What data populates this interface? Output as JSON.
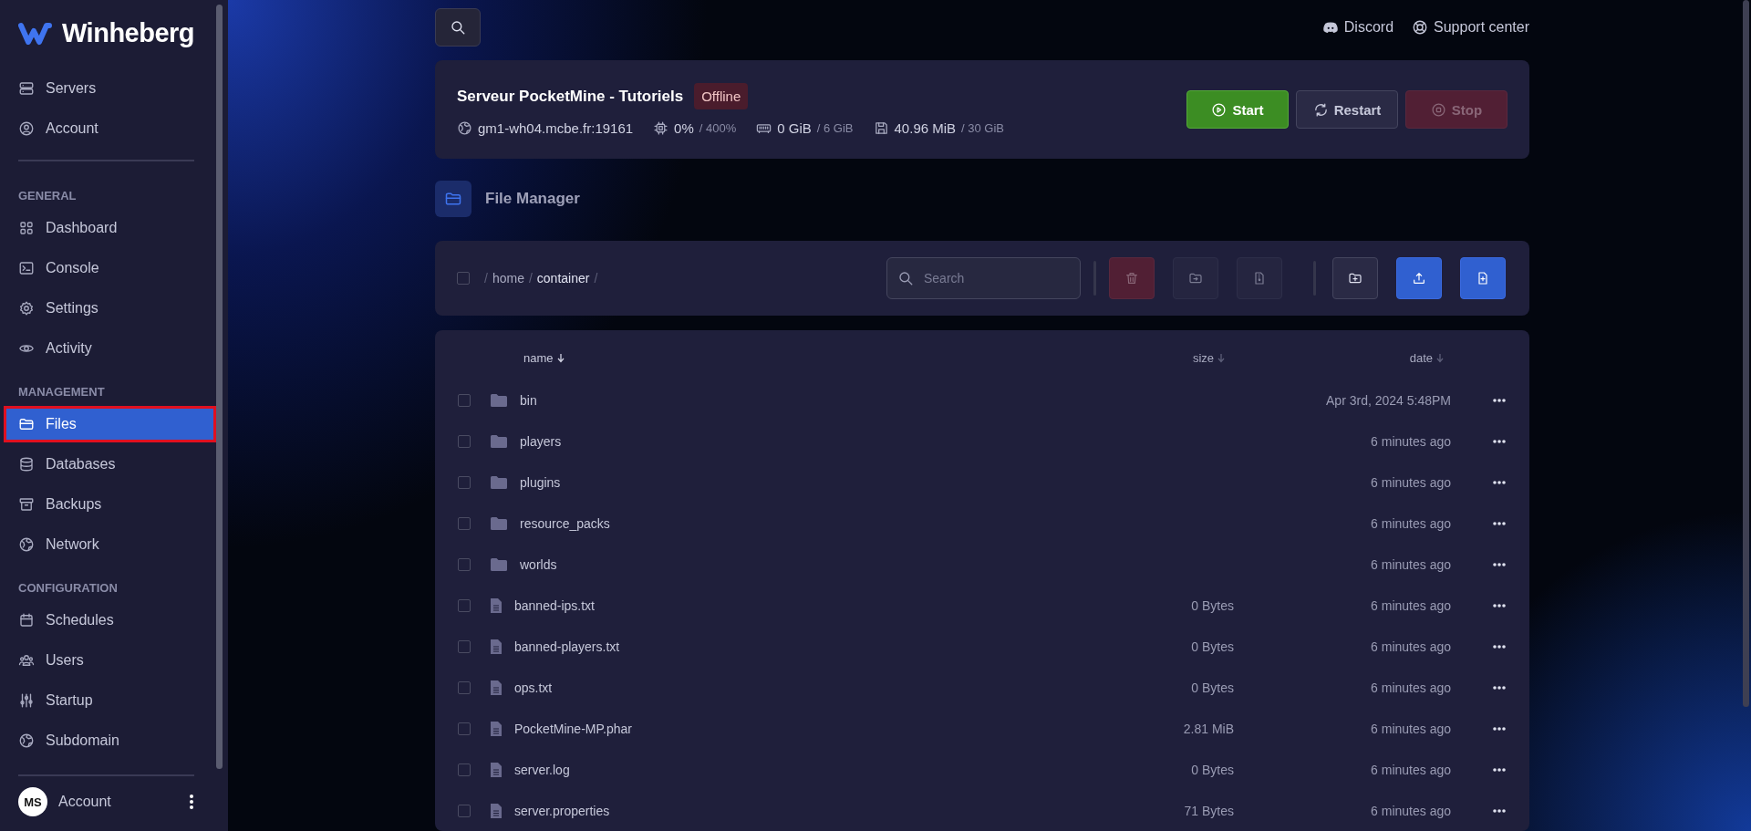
{
  "brand": {
    "name": "Winheberg"
  },
  "sidebar": {
    "top_items": [
      {
        "label": "Servers",
        "kind": "server",
        "selected": false
      },
      {
        "label": "Account",
        "kind": "user",
        "selected": false
      }
    ],
    "sections": [
      {
        "heading": "GENERAL",
        "items": [
          {
            "label": "Dashboard",
            "kind": "grid",
            "selected": false
          },
          {
            "label": "Console",
            "kind": "terminal",
            "selected": false
          },
          {
            "label": "Settings",
            "kind": "gear",
            "selected": false
          },
          {
            "label": "Activity",
            "kind": "eye",
            "selected": false
          }
        ]
      },
      {
        "heading": "MANAGEMENT",
        "items": [
          {
            "label": "Files",
            "kind": "folder",
            "selected": true
          },
          {
            "label": "Databases",
            "kind": "database",
            "selected": false
          },
          {
            "label": "Backups",
            "kind": "archive",
            "selected": false
          },
          {
            "label": "Network",
            "kind": "globe",
            "selected": false
          }
        ]
      },
      {
        "heading": "CONFIGURATION",
        "items": [
          {
            "label": "Schedules",
            "kind": "calendar",
            "selected": false
          },
          {
            "label": "Users",
            "kind": "users",
            "selected": false
          },
          {
            "label": "Startup",
            "kind": "sliders",
            "selected": false
          },
          {
            "label": "Subdomain",
            "kind": "globe",
            "selected": false
          }
        ]
      }
    ],
    "footer": {
      "avatar": "MS",
      "label": "Account"
    }
  },
  "top_links": [
    {
      "label": "Discord",
      "kind": "discord"
    },
    {
      "label": "Support center",
      "kind": "lifebuoy"
    }
  ],
  "server": {
    "name": "Serveur PocketMine - Tutoriels",
    "status": "Offline",
    "address": "gm1-wh04.mcbe.fr:19161",
    "stats": [
      {
        "kind": "cpu",
        "value": "0%",
        "limit": "/ 400%"
      },
      {
        "kind": "memory",
        "value": "0 GiB",
        "limit": "/ 6 GiB"
      },
      {
        "kind": "disk",
        "value": "40.96 MiB",
        "limit": "/ 30 GiB"
      }
    ],
    "buttons": [
      {
        "label": "Start",
        "kind": "start",
        "disabled": false
      },
      {
        "label": "Restart",
        "kind": "restart",
        "disabled": false
      },
      {
        "label": "Stop",
        "kind": "stop",
        "disabled": true
      }
    ]
  },
  "file_manager": {
    "title": "File Manager",
    "select_all_checked": false,
    "separator": "/",
    "breadcrumb": [
      "home",
      "container"
    ],
    "search_placeholder": "Search",
    "actions": [
      {
        "kind": "delete",
        "disabled": true
      },
      {
        "kind": "move",
        "disabled": true
      },
      {
        "kind": "archive",
        "disabled": true
      },
      {
        "kind": "new-folder",
        "disabled": false
      },
      {
        "kind": "upload",
        "disabled": false
      },
      {
        "kind": "new-file",
        "disabled": false
      }
    ],
    "columns": [
      {
        "label": "name",
        "sorted": true
      },
      {
        "label": "size",
        "sorted": false
      },
      {
        "label": "date",
        "sorted": false
      }
    ],
    "rows": [
      {
        "name": "bin",
        "kind": "folder",
        "date": "Apr 3rd, 2024 5:48PM",
        "checked": false
      },
      {
        "name": "players",
        "kind": "folder",
        "date": "6 minutes ago",
        "checked": false
      },
      {
        "name": "plugins",
        "kind": "folder",
        "date": "6 minutes ago",
        "checked": false
      },
      {
        "name": "resource_packs",
        "kind": "folder",
        "date": "6 minutes ago",
        "checked": false
      },
      {
        "name": "worlds",
        "kind": "folder",
        "date": "6 minutes ago",
        "checked": false
      },
      {
        "name": "banned-ips.txt",
        "kind": "file",
        "size": "0 Bytes",
        "date": "6 minutes ago",
        "checked": false
      },
      {
        "name": "banned-players.txt",
        "kind": "file",
        "size": "0 Bytes",
        "date": "6 minutes ago",
        "checked": false
      },
      {
        "name": "ops.txt",
        "kind": "file",
        "size": "0 Bytes",
        "date": "6 minutes ago",
        "checked": false
      },
      {
        "name": "PocketMine-MP.phar",
        "kind": "file",
        "size": "2.81 MiB",
        "date": "6 minutes ago",
        "checked": false
      },
      {
        "name": "server.log",
        "kind": "file",
        "size": "0 Bytes",
        "date": "6 minutes ago",
        "checked": false
      },
      {
        "name": "server.properties",
        "kind": "file",
        "size": "71 Bytes",
        "date": "6 minutes ago",
        "checked": false
      }
    ]
  }
}
